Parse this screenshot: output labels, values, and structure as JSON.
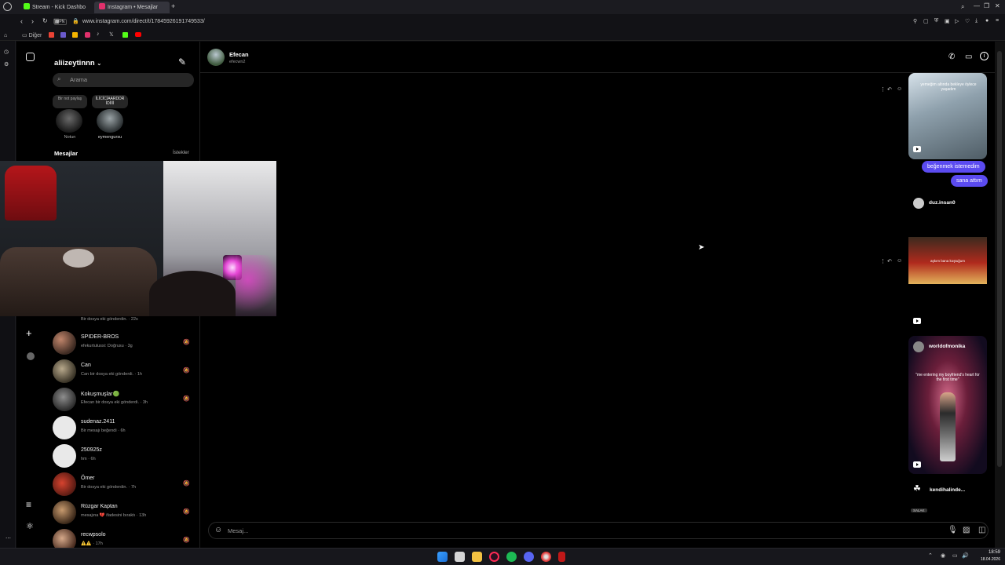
{
  "browser": {
    "tabs": [
      {
        "label": "Stream - Kick Dashbo",
        "active": false
      },
      {
        "label": "Instagram • Mesajlar",
        "active": true
      }
    ],
    "vpn_badge": "VPN",
    "url": "www.instagram.com/direct/t/17845926191749533/",
    "bookmarks_folder": "Diğer"
  },
  "sidebar": {
    "username": "aliizeytinnn",
    "search_placeholder": "Arama",
    "notes": [
      {
        "bubble": "Bir not paylaş",
        "label": "Notun"
      },
      {
        "bubble": "İLİCİCİAARDDR İDİİİİ",
        "label": "eymengursu"
      }
    ],
    "messages_heading": "Mesajlar",
    "requests_link": "İstekler",
    "partial_preview": "Bir dosya eki gönderdin. · 22s",
    "conversations": [
      {
        "name": "SPIDER-BROS",
        "preview": "efekurtulussi: Doğrusu · 3g",
        "muted": true
      },
      {
        "name": "Can",
        "preview": "Can bir dosya eki gönderdi. · 1h",
        "muted": true
      },
      {
        "name": "Kokuşmuşlar🟢",
        "preview": "Efecan bir dosya eki gönderdi. · 3h",
        "muted": true
      },
      {
        "name": "sudenaz.2411",
        "preview": "Bir mesajı beğendi · 6h",
        "muted": false
      },
      {
        "name": "250925z",
        "preview": "hm · 6h",
        "muted": false
      },
      {
        "name": "Ömer",
        "preview": "Bir dosya eki gönderdin. · 7h",
        "muted": true
      },
      {
        "name": "Rüzgar Kaptan",
        "preview": "mesajına 💔 ifadesini bıraktı · 13h",
        "muted": true
      },
      {
        "name": "recwpsolo",
        "preview": "⚠️⚠️ · 17h",
        "muted": true
      }
    ]
  },
  "chat": {
    "contact_name": "Efecan",
    "contact_handle": "efecwn2",
    "messages": {
      "reel1_caption": "yemeğim altında bekleye öylece yaşadım",
      "bubble1": "beğenmek istemedim",
      "bubble2": "sana attım",
      "reel2_user": "duz.insan0",
      "reel2_caption": "aşkım bana koştuğum",
      "reel3_user": "worldofmonika",
      "reel3_caption": "\"me entering my boyfriend's heart for the first time\"",
      "reel4_user": "kendihalinde...",
      "reel4_tag": "SALAK"
    },
    "composer_placeholder": "Mesaj..."
  },
  "taskbar": {
    "time": "18:59",
    "date": "18.04.2026"
  },
  "colors": {
    "accent": "#5b4bf0",
    "background": "#000000",
    "kick_green": "#53fc18"
  }
}
